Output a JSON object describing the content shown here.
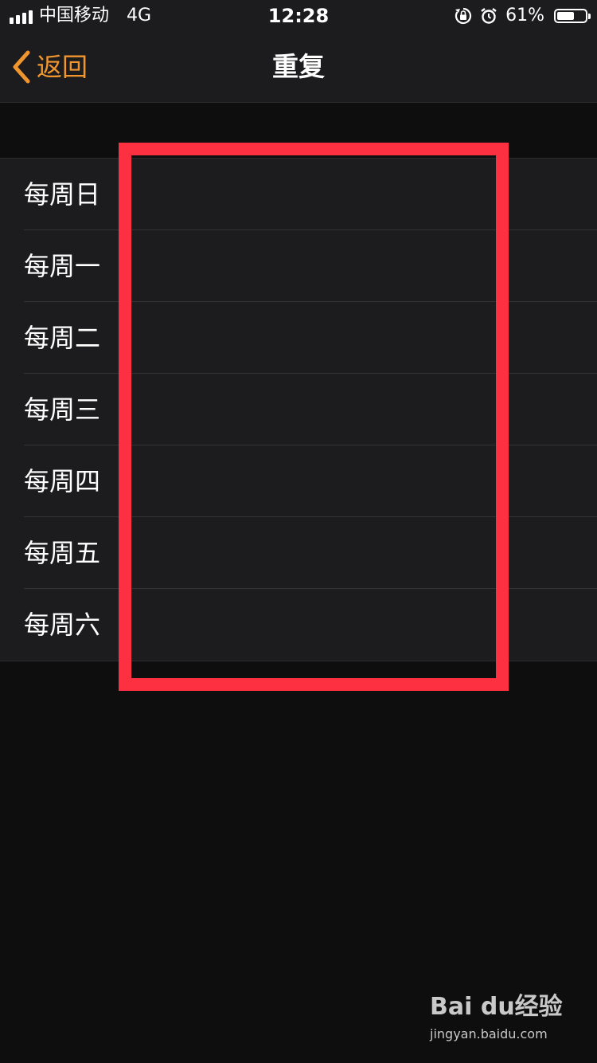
{
  "status_bar": {
    "carrier": "中国移动",
    "network": "4G",
    "time": "12:28",
    "battery_percent": "61%",
    "battery_level": 0.61,
    "icons": [
      "signal-icon",
      "rotation-lock-icon",
      "alarm-icon",
      "battery-icon"
    ]
  },
  "nav": {
    "back_label": "返回",
    "title": "重复",
    "accent_color": "#f1962e"
  },
  "repeat_options": [
    {
      "label": "每周日"
    },
    {
      "label": "每周一"
    },
    {
      "label": "每周二"
    },
    {
      "label": "每周三"
    },
    {
      "label": "每周四"
    },
    {
      "label": "每周五"
    },
    {
      "label": "每周六"
    }
  ],
  "annotation": {
    "color": "#fd3042"
  },
  "watermark": {
    "logo": "Bai du经验",
    "url": "jingyan.baidu.com"
  }
}
